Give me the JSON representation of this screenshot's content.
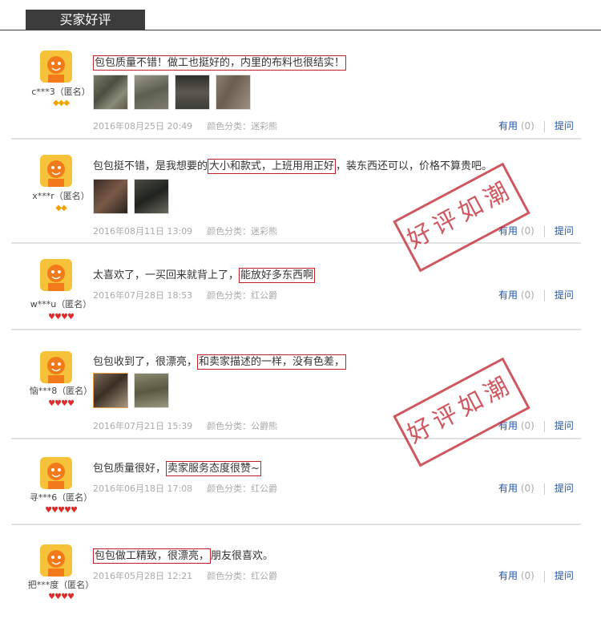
{
  "header": {
    "title": "买家好评"
  },
  "actions": {
    "useful_label": "有用",
    "reply_label": "提问"
  },
  "stamp_text": "好评如潮",
  "colors": {
    "accent": "#c0202a",
    "link": "#2255aa",
    "header_bg": "#3c3c3c",
    "avatar": "#f6c23a"
  },
  "reviews": [
    {
      "user": "c***3（匿名）",
      "badges": "◆◆◆",
      "content_pre": "",
      "content_hl": "包包质量不错！做工也挺好的，内里的布料也很结实！",
      "content_post": "",
      "date": "2016年08月25日 20:49",
      "color": "颜色分类：迷彩熊",
      "useful_count": "(0)"
    },
    {
      "user": "x***r（匿名）",
      "badges": "◆◆",
      "content_pre": "包包挺不错，是我想要的",
      "content_hl": "大小和款式，上班用用正好",
      "content_post": "，装东西还可以，价格不算贵吧。",
      "date": "2016年08月11日 13:09",
      "color": "颜色分类：迷彩熊",
      "useful_count": "(0)"
    },
    {
      "user": "w***u（匿名）",
      "badges": "♥♥♥♥",
      "content_pre": "太喜欢了，一买回来就背上了，",
      "content_hl": "能放好多东西啊",
      "content_post": "",
      "date": "2016年07月28日 18:53",
      "color": "颜色分类：红公爵",
      "useful_count": "(0)"
    },
    {
      "user": "恼***8（匿名）",
      "badges": "♥♥♥♥",
      "content_pre": "包包收到了，很漂亮，",
      "content_hl": "和卖家描述的一样，没有色差，",
      "content_post": "",
      "date": "2016年07月21日 15:39",
      "color": "颜色分类：公爵熊",
      "useful_count": "(0)"
    },
    {
      "user": "寻***6（匿名）",
      "badges": "♥♥♥♥♥",
      "content_pre": "包包质量很好，",
      "content_hl": "卖家服务态度很赞~",
      "content_post": "",
      "date": "2016年06月18日 17:08",
      "color": "颜色分类：红公爵",
      "useful_count": "(0)"
    },
    {
      "user": "把***度（匿名）",
      "badges": "♥♥♥♥",
      "content_pre": "",
      "content_hl": "包包做工精致，很漂亮，",
      "content_post": "朋友很喜欢。",
      "date": "2016年05月28日 12:21",
      "color": "颜色分类：红公爵",
      "useful_count": "(0)"
    }
  ]
}
